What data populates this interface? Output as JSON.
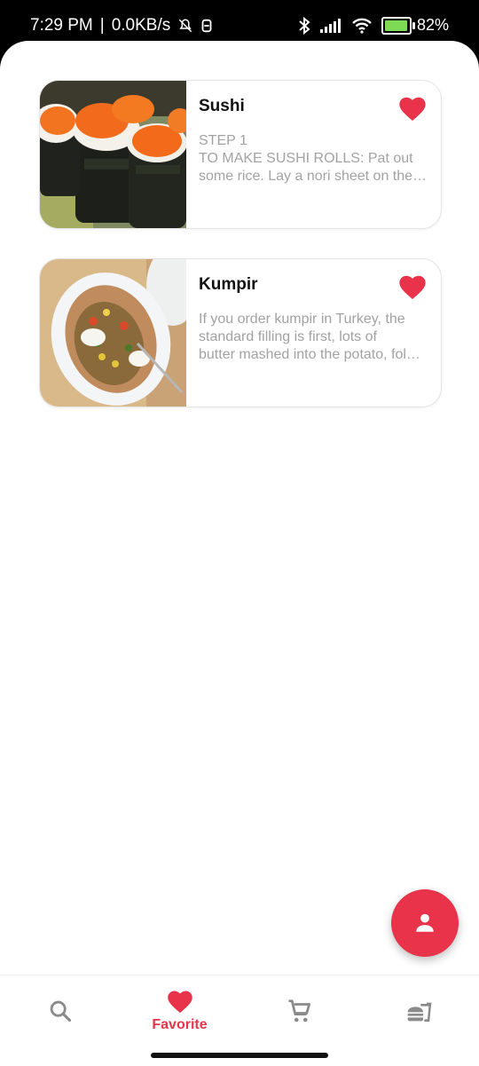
{
  "status_bar": {
    "time": "7:29 PM",
    "separator": "|",
    "network_speed": "0.0KB/s",
    "battery_percent": "82%"
  },
  "favorites": [
    {
      "title": "Sushi",
      "description_lines": [
        "STEP 1",
        "TO MAKE SUSHI ROLLS: Pat out",
        "some rice. Lay a nori sheet on the…"
      ],
      "favorited": true
    },
    {
      "title": "Kumpir",
      "description_lines": [
        "If you order kumpir in Turkey, the",
        "standard filling is first, lots of",
        "butter mashed into the potato, fol…"
      ],
      "favorited": true
    }
  ],
  "fab": {
    "icon": "person-icon"
  },
  "bottom_nav": {
    "items": [
      {
        "id": "search",
        "icon": "search-icon",
        "label": ""
      },
      {
        "id": "favorite",
        "icon": "heart-icon",
        "label": "Favorite",
        "active": true
      },
      {
        "id": "cart",
        "icon": "cart-icon",
        "label": ""
      },
      {
        "id": "food",
        "icon": "fastfood-icon",
        "label": ""
      }
    ]
  },
  "colors": {
    "accent": "#e8334a",
    "inactive_icon": "#8a8a8a",
    "description_text": "#a2a2a2"
  }
}
